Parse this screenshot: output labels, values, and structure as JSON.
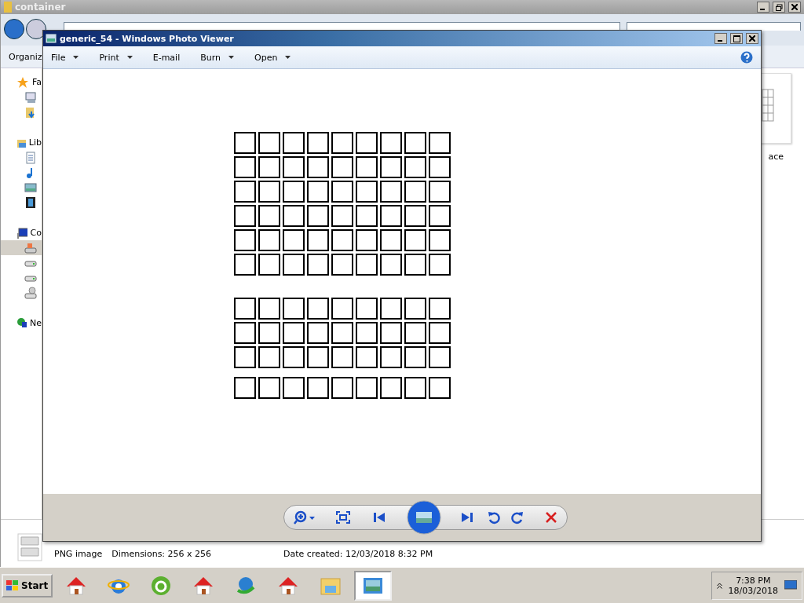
{
  "explorer": {
    "title": "container",
    "toolbar_label": "Organiz",
    "nav": [
      {
        "label": "Fa",
        "kind": "star",
        "children": [
          {
            "kind": "recent",
            "selected": false
          },
          {
            "kind": "downloads",
            "selected": false
          }
        ]
      },
      {
        "label": "Lib",
        "kind": "library",
        "children": [
          {
            "kind": "document",
            "selected": false
          },
          {
            "kind": "music",
            "selected": false
          },
          {
            "kind": "image",
            "selected": false
          },
          {
            "kind": "video",
            "selected": false
          }
        ]
      },
      {
        "label": "Co",
        "kind": "computer",
        "children": [
          {
            "kind": "system-drive",
            "selected": true
          },
          {
            "kind": "drive",
            "selected": false
          },
          {
            "kind": "drive",
            "selected": false
          },
          {
            "kind": "disc-drive",
            "selected": false
          }
        ]
      },
      {
        "label": "Ne",
        "kind": "network"
      }
    ],
    "file_label": "ace",
    "details": {
      "type": "PNG image",
      "dimensions": "Dimensions: 256 x 256",
      "date": "Date created: 12/03/2018 8:32 PM"
    }
  },
  "viewer": {
    "title": "generic_54 - Windows Photo Viewer",
    "menu": [
      {
        "label": "File",
        "dropdown": true
      },
      {
        "label": "Print",
        "dropdown": true
      },
      {
        "label": "E-mail",
        "dropdown": false
      },
      {
        "label": "Burn",
        "dropdown": true
      },
      {
        "label": "Open",
        "dropdown": true
      }
    ]
  },
  "taskbar": {
    "start": "Start",
    "apps": [
      {
        "kind": "home",
        "selected": false
      },
      {
        "kind": "browser",
        "selected": false
      },
      {
        "kind": "ring-logo",
        "selected": false
      },
      {
        "kind": "home",
        "selected": false
      },
      {
        "kind": "download",
        "selected": false
      },
      {
        "kind": "home",
        "selected": false
      },
      {
        "kind": "folder",
        "selected": false
      },
      {
        "kind": "photo",
        "selected": true
      }
    ],
    "time": "7:38 PM",
    "date": "18/03/2018"
  }
}
